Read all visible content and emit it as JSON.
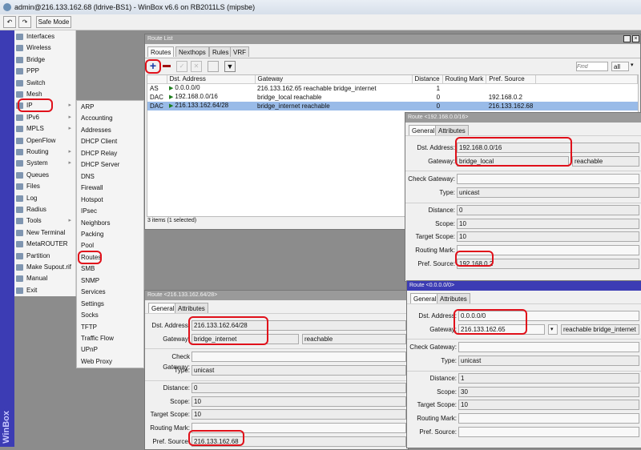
{
  "window_title": "admin@216.133.162.68 (ldrive-BS1) - WinBox v6.6 on RB2011LS (mipsbe)",
  "toolbar": {
    "undo": "undo-icon",
    "redo": "redo-icon",
    "safe_mode": "Safe Mode"
  },
  "brand": "WinBox",
  "menu": [
    {
      "label": "Interfaces"
    },
    {
      "label": "Wireless"
    },
    {
      "label": "Bridge"
    },
    {
      "label": "PPP"
    },
    {
      "label": "Switch"
    },
    {
      "label": "Mesh"
    },
    {
      "label": "IP",
      "sub": true,
      "highlight": true
    },
    {
      "label": "IPv6",
      "sub": true
    },
    {
      "label": "MPLS",
      "sub": true
    },
    {
      "label": "OpenFlow"
    },
    {
      "label": "Routing",
      "sub": true
    },
    {
      "label": "System",
      "sub": true
    },
    {
      "label": "Queues"
    },
    {
      "label": "Files"
    },
    {
      "label": "Log"
    },
    {
      "label": "Radius"
    },
    {
      "label": "Tools",
      "sub": true
    },
    {
      "label": "New Terminal"
    },
    {
      "label": "MetaROUTER"
    },
    {
      "label": "Partition"
    },
    {
      "label": "Make Supout.rif"
    },
    {
      "label": "Manual"
    },
    {
      "label": "Exit"
    }
  ],
  "ip_submenu": [
    "ARP",
    "Accounting",
    "Addresses",
    "DHCP Client",
    "DHCP Relay",
    "DHCP Server",
    "DNS",
    "Firewall",
    "Hotspot",
    "IPsec",
    "Neighbors",
    "Packing",
    "Pool",
    "Routes",
    "SMB",
    "SNMP",
    "Services",
    "Settings",
    "Socks",
    "TFTP",
    "Traffic Flow",
    "UPnP",
    "Web Proxy"
  ],
  "ip_submenu_highlight": "Routes",
  "route_list": {
    "title": "Route List",
    "tabs": [
      "Routes",
      "Nexthops",
      "Rules",
      "VRF"
    ],
    "find_placeholder": "Find",
    "filter_value": "all",
    "columns": [
      "",
      "Dst. Address",
      "Gateway",
      "Distance",
      "Routing Mark",
      "Pref. Source"
    ],
    "rows": [
      {
        "type": "AS",
        "dst": "0.0.0.0/0",
        "gateway": "216.133.162.65 reachable bridge_internet",
        "distance": "1",
        "mark": "",
        "pref": ""
      },
      {
        "type": "DAC",
        "dst": "192.168.0.0/16",
        "gateway": "bridge_local reachable",
        "distance": "0",
        "mark": "",
        "pref": "192.168.0.2"
      },
      {
        "type": "DAC",
        "dst": "216.133.162.64/28",
        "gateway": "bridge_internet reachable",
        "distance": "0",
        "mark": "",
        "pref": "216.133.162.68",
        "selected": true
      }
    ],
    "status": "3 items (1 selected)"
  },
  "labels": {
    "dst": "Dst. Address:",
    "gateway": "Gateway:",
    "check": "Check Gateway:",
    "type": "Type:",
    "distance": "Distance:",
    "scope": "Scope:",
    "target": "Target Scope:",
    "mark": "Routing Mark:",
    "pref": "Pref. Source:"
  },
  "route_windows": [
    {
      "title": "Route <192.168.0.0/16>",
      "tabs": [
        "General",
        "Attributes"
      ],
      "dst": "192.168.0.0/16",
      "gateway": "bridge_local",
      "gw_status": "reachable",
      "check": "",
      "type": "unicast",
      "distance": "0",
      "scope": "10",
      "target": "10",
      "mark": "",
      "pref": "192.168.0.2"
    },
    {
      "title": "Route <216.133.162.64/28>",
      "tabs": [
        "General",
        "Attributes"
      ],
      "dst": "216.133.162.64/28",
      "gateway": "bridge_internet",
      "gw_status": "reachable",
      "check": "",
      "type": "unicast",
      "distance": "0",
      "scope": "10",
      "target": "10",
      "mark": "",
      "pref": "216.133.162.68"
    },
    {
      "title": "Route <0.0.0.0/0>",
      "tabs": [
        "General",
        "Attributes"
      ],
      "dst": "0.0.0.0/0",
      "gateway": "216.133.162.65",
      "gw_status": "reachable bridge_internet",
      "check": "",
      "type": "unicast",
      "distance": "1",
      "scope": "30",
      "target": "10",
      "mark": "",
      "pref": ""
    }
  ],
  "colors": {
    "highlight": "#e0101a",
    "brand_strip": "#3c3cb4",
    "selected_row": "#99bbe8"
  }
}
